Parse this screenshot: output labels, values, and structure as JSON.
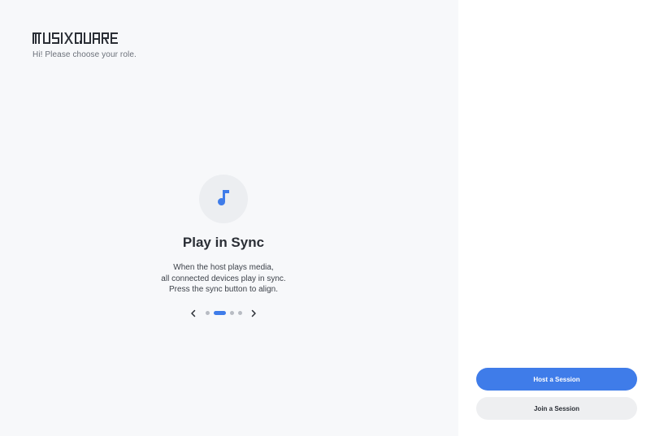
{
  "brand": {
    "logo_text": "MUSIXQUARE",
    "subtitle": "Hi! Please choose your role."
  },
  "slide": {
    "icon": "music-note-icon",
    "title": "Play in Sync",
    "description": [
      "When the host plays media,",
      "all connected devices play in sync.",
      "Press the sync button to align."
    ]
  },
  "pager": {
    "total": 4,
    "active_index": 1
  },
  "actions": {
    "host_label": "Host a Session",
    "join_label": "Join a Session"
  },
  "colors": {
    "accent": "#3f7ce9",
    "left_bg": "#f7f8fa",
    "dot_inactive": "#b8bcc3"
  }
}
